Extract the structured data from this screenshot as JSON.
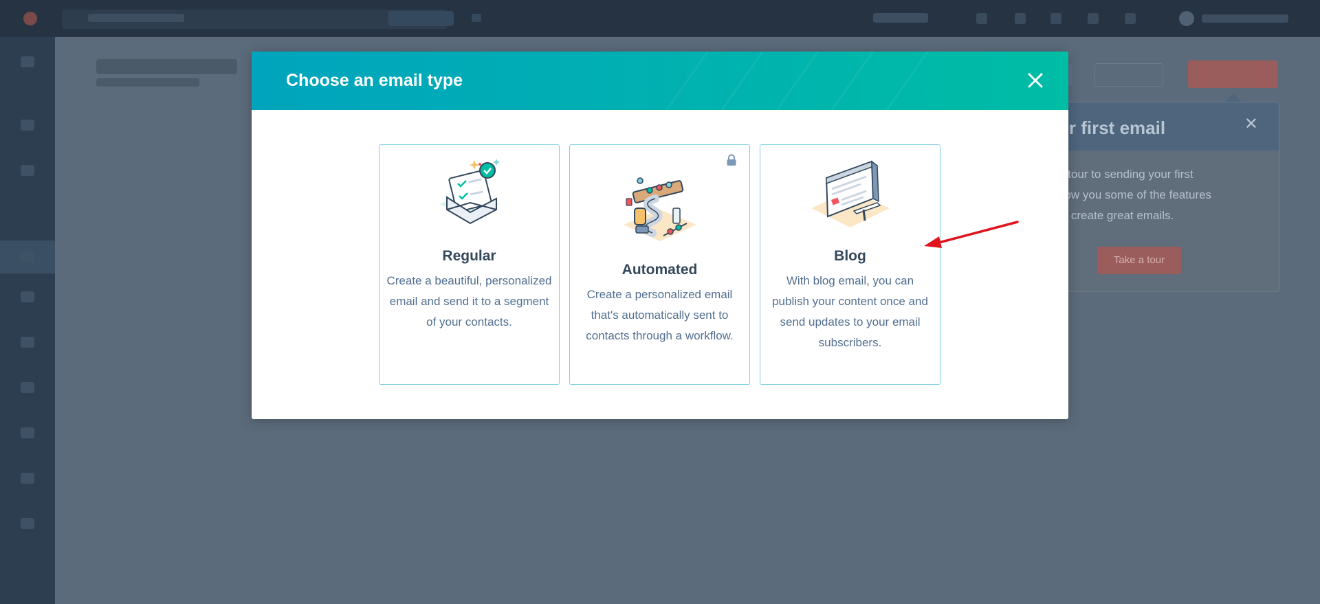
{
  "background": {
    "tour": {
      "title": "ur first email",
      "body": "d tour to sending your first\nhow you some of the features\nto create great emails.",
      "take_tour_label": "Take a tour"
    }
  },
  "modal": {
    "title": "Choose an email type",
    "close_icon": "close-icon",
    "header_color_start": "#00a4bd",
    "header_color_end": "#00bda5",
    "cards": [
      {
        "title": "Regular",
        "description": "Create a beautiful, personalized email and send it to a segment of your contacts.",
        "icon": "envelope-check-icon",
        "locked": false
      },
      {
        "title": "Automated",
        "description": "Create a personalized email that's automatically sent to contacts through a workflow.",
        "icon": "automation-machine-icon",
        "locked": true
      },
      {
        "title": "Blog",
        "description": "With blog email, you can publish your content once and send updates to your email subscribers.",
        "icon": "blog-monitor-icon",
        "locked": false
      }
    ]
  },
  "annotation": {
    "arrow_color": "#e0141e"
  }
}
